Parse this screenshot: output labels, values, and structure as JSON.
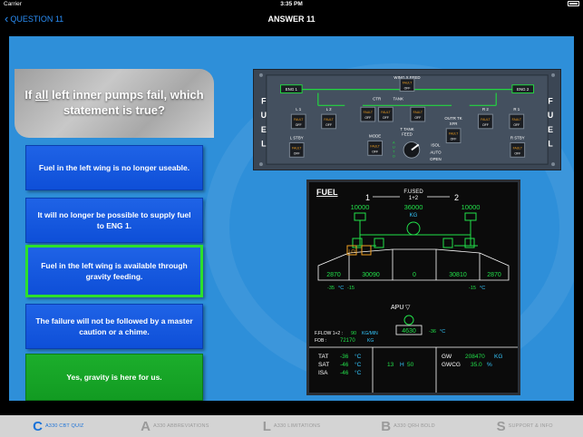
{
  "status": {
    "carrier": "Carrier",
    "time": "3:35 PM",
    "battery_percent": 100
  },
  "nav": {
    "back_label": "QUESTION 11",
    "title": "ANSWER 11"
  },
  "question": {
    "pre": "If ",
    "emph": "all",
    "post": " left inner pumps fail, which statement is true?"
  },
  "answers": [
    {
      "text": "Fuel in the left wing is no longer useable.",
      "state": "normal"
    },
    {
      "text": "It will no longer be possible to supply fuel to ENG 1.",
      "state": "normal"
    },
    {
      "text": "Fuel in the left wing is available through gravity feeding.",
      "state": "selected"
    },
    {
      "text": "The failure will not be followed by a master caution or a chime.",
      "state": "normal"
    },
    {
      "text": "Yes, gravity is here for us.",
      "state": "correct"
    }
  ],
  "overhead": {
    "side_label": [
      "F",
      "U",
      "E",
      "L"
    ],
    "wing_x_feed": "WING X FEED",
    "eng1": "ENG 1",
    "eng2": "ENG 2",
    "ctr_tank": "CTR",
    "tank": "TANK",
    "l1": "L 1",
    "l2": "L 2",
    "r1": "R 1",
    "r2": "R 2",
    "l_stby": "L STBY",
    "r_stby": "R STBY",
    "mode": "MODE",
    "auto": "AUTO",
    "t_tank": "T TANK",
    "feed": "FEED",
    "isol": "ISOL",
    "open": "OPEN",
    "outr_tk": "OUTR TK",
    "xfr": "XFR",
    "fault": "FAULT",
    "off": "OFF",
    "rotary": [
      "A",
      "U",
      "T",
      "O"
    ]
  },
  "ecam": {
    "title": "FUEL",
    "f_used": "F.USED",
    "f_used_sub": "1+2",
    "eng1_num": "1",
    "eng2_num": "2",
    "used_left": "10000",
    "used_total": "36000",
    "used_unit": "KG",
    "used_right": "10000",
    "lo": "LO",
    "outer_left": "2870",
    "inner_left": "30090",
    "center": "0",
    "inner_right": "30810",
    "outer_right": "2870",
    "temp_left_outer": "-35",
    "temp_left_inner": "-15",
    "temp_right_inner": "-15",
    "temp_right_outer": "-35",
    "deg_c": "°C",
    "apu": "APU",
    "trim": "4630",
    "trim_temp": "-36",
    "fflow_label": "F.FLOW 1+2 :",
    "fflow_value": "90",
    "fflow_unit": "KG/MIN",
    "fob_label": "FOB :",
    "fob_value": "72170",
    "fob_unit": "KG",
    "tat_label": "TAT",
    "tat": "-36",
    "sat_label": "SAT",
    "sat": "-46",
    "isa_label": "ISA",
    "isa": "-46",
    "clock_h": "13",
    "clock_h_label": "H",
    "clock_m": "50",
    "gw_label": "GW",
    "gw": "208470",
    "gw_unit": "KG",
    "gwcg_label": "GWCG",
    "gwcg": "35.0",
    "gwcg_unit": "%"
  },
  "tabs": [
    {
      "letter": "C",
      "label": "A330 CBT QUIZ",
      "active": true
    },
    {
      "letter": "A",
      "label": "A330 ABBREVIATIONS",
      "active": false
    },
    {
      "letter": "L",
      "label": "A330 LIMITATIONS",
      "active": false
    },
    {
      "letter": "B",
      "label": "A330 QRH BOLD",
      "active": false
    },
    {
      "letter": "S",
      "label": "SUPPORT & INFO",
      "active": false
    }
  ],
  "colors": {
    "panel_blue": "#2e8fd9",
    "answer_blue": "#1f63e6",
    "correct_green": "#1cae2c",
    "selected_border": "#2ce02c",
    "ecam_green": "#22e04a",
    "ecam_cyan": "#35c8ff",
    "ecam_amber": "#f0a020",
    "tab_active": "#1a72d8"
  }
}
